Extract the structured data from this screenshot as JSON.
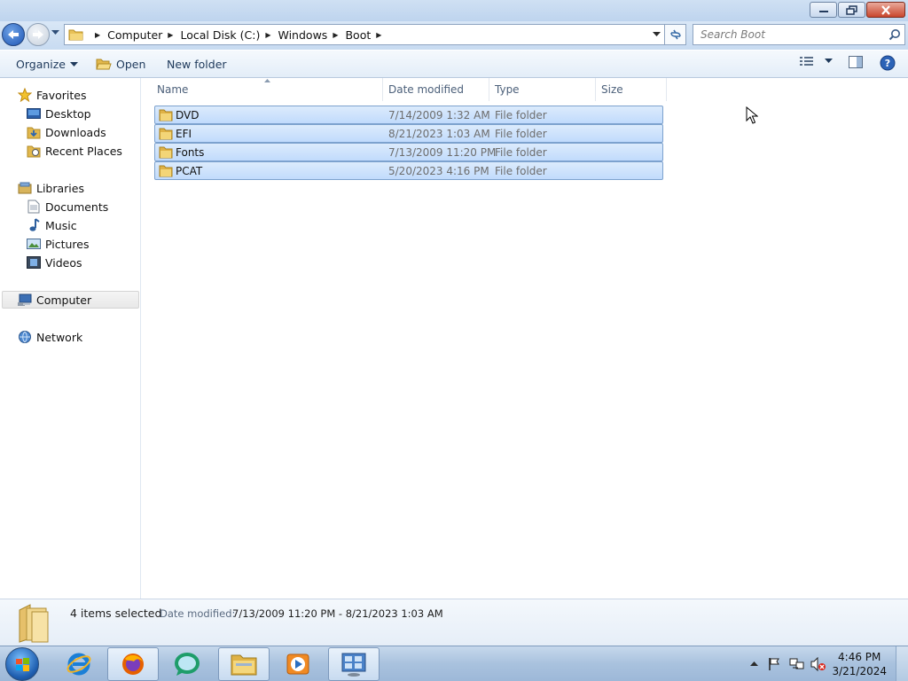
{
  "window": {
    "buttons": {
      "minimize_icon": "minimize-icon",
      "maximize_icon": "restore-icon",
      "close_icon": "close-icon"
    }
  },
  "address": {
    "breadcrumbs": [
      "Computer",
      "Local Disk (C:)",
      "Windows",
      "Boot"
    ],
    "search_placeholder": "Search Boot"
  },
  "toolbar": {
    "organize_label": "Organize",
    "open_label": "Open",
    "new_folder_label": "New folder"
  },
  "nav": {
    "favorites": "Favorites",
    "desktop": "Desktop",
    "downloads": "Downloads",
    "recent_places": "Recent Places",
    "libraries": "Libraries",
    "documents": "Documents",
    "music": "Music",
    "pictures": "Pictures",
    "videos": "Videos",
    "computer": "Computer",
    "network": "Network"
  },
  "columns": {
    "name": "Name",
    "date": "Date modified",
    "type": "Type",
    "size": "Size"
  },
  "files": [
    {
      "name": "DVD",
      "date": "7/14/2009 1:32 AM",
      "type": "File folder"
    },
    {
      "name": "EFI",
      "date": "8/21/2023 1:03 AM",
      "type": "File folder"
    },
    {
      "name": "Fonts",
      "date": "7/13/2009 11:20 PM",
      "type": "File folder"
    },
    {
      "name": "PCAT",
      "date": "5/20/2023 4:16 PM",
      "type": "File folder"
    }
  ],
  "details": {
    "count": "4 items selected",
    "date_label": "Date modified:",
    "date_value": "7/13/2009 11:20 PM - 8/21/2023 1:03 AM"
  },
  "taskbar": {
    "time": "4:46 PM",
    "date": "3/21/2024"
  },
  "colors": {
    "selection": "#c9e0fc",
    "selection_border": "#7da2ce",
    "taskbar": "#a9c2de"
  }
}
